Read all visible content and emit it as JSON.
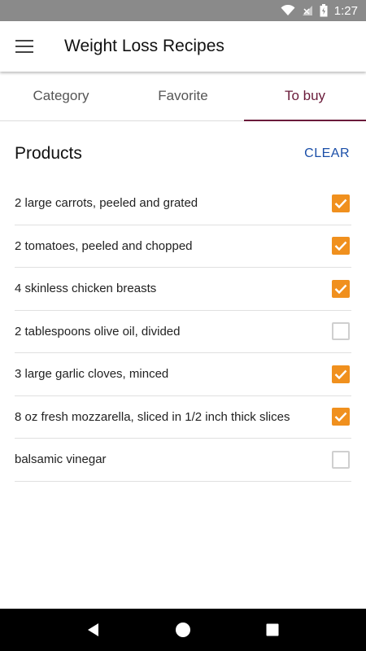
{
  "status_bar": {
    "time": "1:27",
    "icons": [
      "wifi-icon",
      "signal-icon",
      "battery-icon"
    ]
  },
  "app_bar": {
    "title": "Weight Loss Recipes",
    "menu_icon": "hamburger-menu-icon"
  },
  "tabs": [
    {
      "label": "Category",
      "active": false
    },
    {
      "label": "Favorite",
      "active": false
    },
    {
      "label": "To buy",
      "active": true
    }
  ],
  "products": {
    "title": "Products",
    "clear_label": "CLEAR",
    "items": [
      {
        "label": "2 large carrots, peeled and grated",
        "checked": true
      },
      {
        "label": "2 tomatoes, peeled and chopped",
        "checked": true
      },
      {
        "label": "4 skinless chicken breasts",
        "checked": true
      },
      {
        "label": "2 tablespoons olive oil, divided",
        "checked": false
      },
      {
        "label": "3 large garlic cloves, minced",
        "checked": true
      },
      {
        "label": "8 oz fresh mozzarella, sliced in 1/2 inch thick slices",
        "checked": true
      },
      {
        "label": "balsamic vinegar",
        "checked": false
      }
    ]
  },
  "colors": {
    "accent": "#6a1b3a",
    "checkbox": "#f0901e",
    "link": "#1a4ea8"
  },
  "nav_bar": {
    "buttons": [
      "back-icon",
      "home-icon",
      "recents-icon"
    ]
  }
}
